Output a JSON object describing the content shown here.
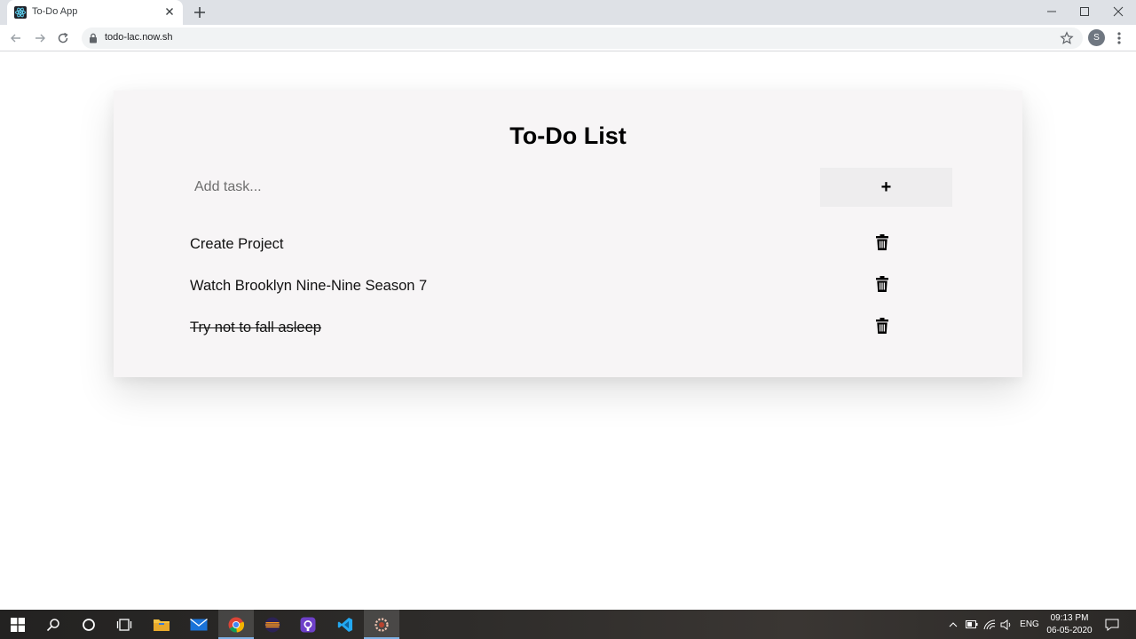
{
  "browser": {
    "tab_title": "To-Do App",
    "url": "todo-lac.now.sh",
    "profile_initial": "S"
  },
  "app": {
    "title": "To-Do List",
    "input_placeholder": "Add task...",
    "add_button_label": "+",
    "tasks": [
      {
        "label": "Create Project",
        "completed": false
      },
      {
        "label": "Watch Brooklyn Nine-Nine Season 7",
        "completed": false
      },
      {
        "label": "Try not to fall asleep",
        "completed": true
      }
    ]
  },
  "taskbar": {
    "language": "ENG",
    "time": "09:13 PM",
    "date": "06-05-2020",
    "apps": [
      "start-icon",
      "search-icon",
      "cortana-icon",
      "task-view-icon",
      "file-explorer-icon",
      "mail-icon",
      "chrome-icon",
      "eclipse-icon",
      "github-desktop-icon",
      "vscode-icon",
      "settings-app-icon"
    ]
  },
  "colors": {
    "card_background": "#f7f5f6",
    "add_button_background": "#eeedee",
    "tab_strip": "#dee1e6",
    "taskbar_active_underline": "#7fb2e6"
  }
}
